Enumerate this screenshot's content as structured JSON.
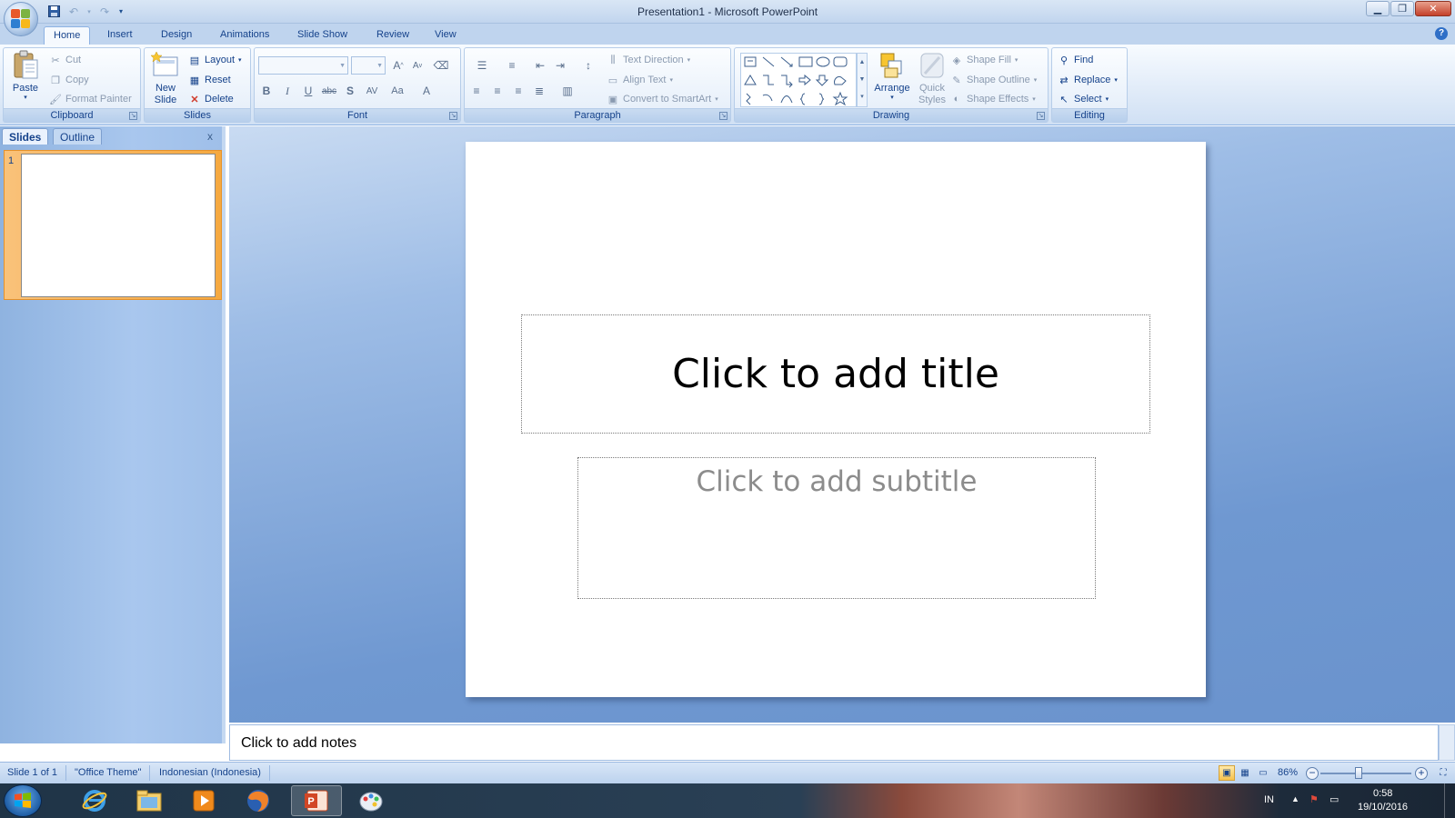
{
  "window": {
    "title": "Presentation1 - Microsoft PowerPoint"
  },
  "tabs": [
    "Home",
    "Insert",
    "Design",
    "Animations",
    "Slide Show",
    "Review",
    "View"
  ],
  "ribbon": {
    "clipboard": {
      "label": "Clipboard",
      "paste": "Paste",
      "cut": "Cut",
      "copy": "Copy",
      "format_painter": "Format Painter"
    },
    "slides": {
      "label": "Slides",
      "new_slide": "New Slide",
      "layout": "Layout",
      "reset": "Reset",
      "delete": "Delete"
    },
    "font": {
      "label": "Font"
    },
    "paragraph": {
      "label": "Paragraph",
      "text_direction": "Text Direction",
      "align_text": "Align Text",
      "convert_smartart": "Convert to SmartArt"
    },
    "drawing": {
      "label": "Drawing",
      "arrange": "Arrange",
      "quick_styles": "Quick Styles",
      "shape_fill": "Shape Fill",
      "shape_outline": "Shape Outline",
      "shape_effects": "Shape Effects"
    },
    "editing": {
      "label": "Editing",
      "find": "Find",
      "replace": "Replace",
      "select": "Select"
    }
  },
  "panel": {
    "tab_slides": "Slides",
    "tab_outline": "Outline",
    "close": "x",
    "slide_number": "1"
  },
  "slide": {
    "title_placeholder": "Click to add title",
    "subtitle_placeholder": "Click to add subtitle"
  },
  "notes": {
    "placeholder": "Click to add notes"
  },
  "status": {
    "slide_of": "Slide 1 of 1",
    "theme": "\"Office Theme\"",
    "language": "Indonesian (Indonesia)",
    "zoom": "86%"
  },
  "taskbar": {
    "lang": "IN",
    "time": "0:58",
    "date": "19/10/2016"
  },
  "colors": {
    "accent": "#15428b",
    "ribbon": "#dce8f7",
    "canvas": "#6f98d1",
    "selection": "#f6a940"
  }
}
